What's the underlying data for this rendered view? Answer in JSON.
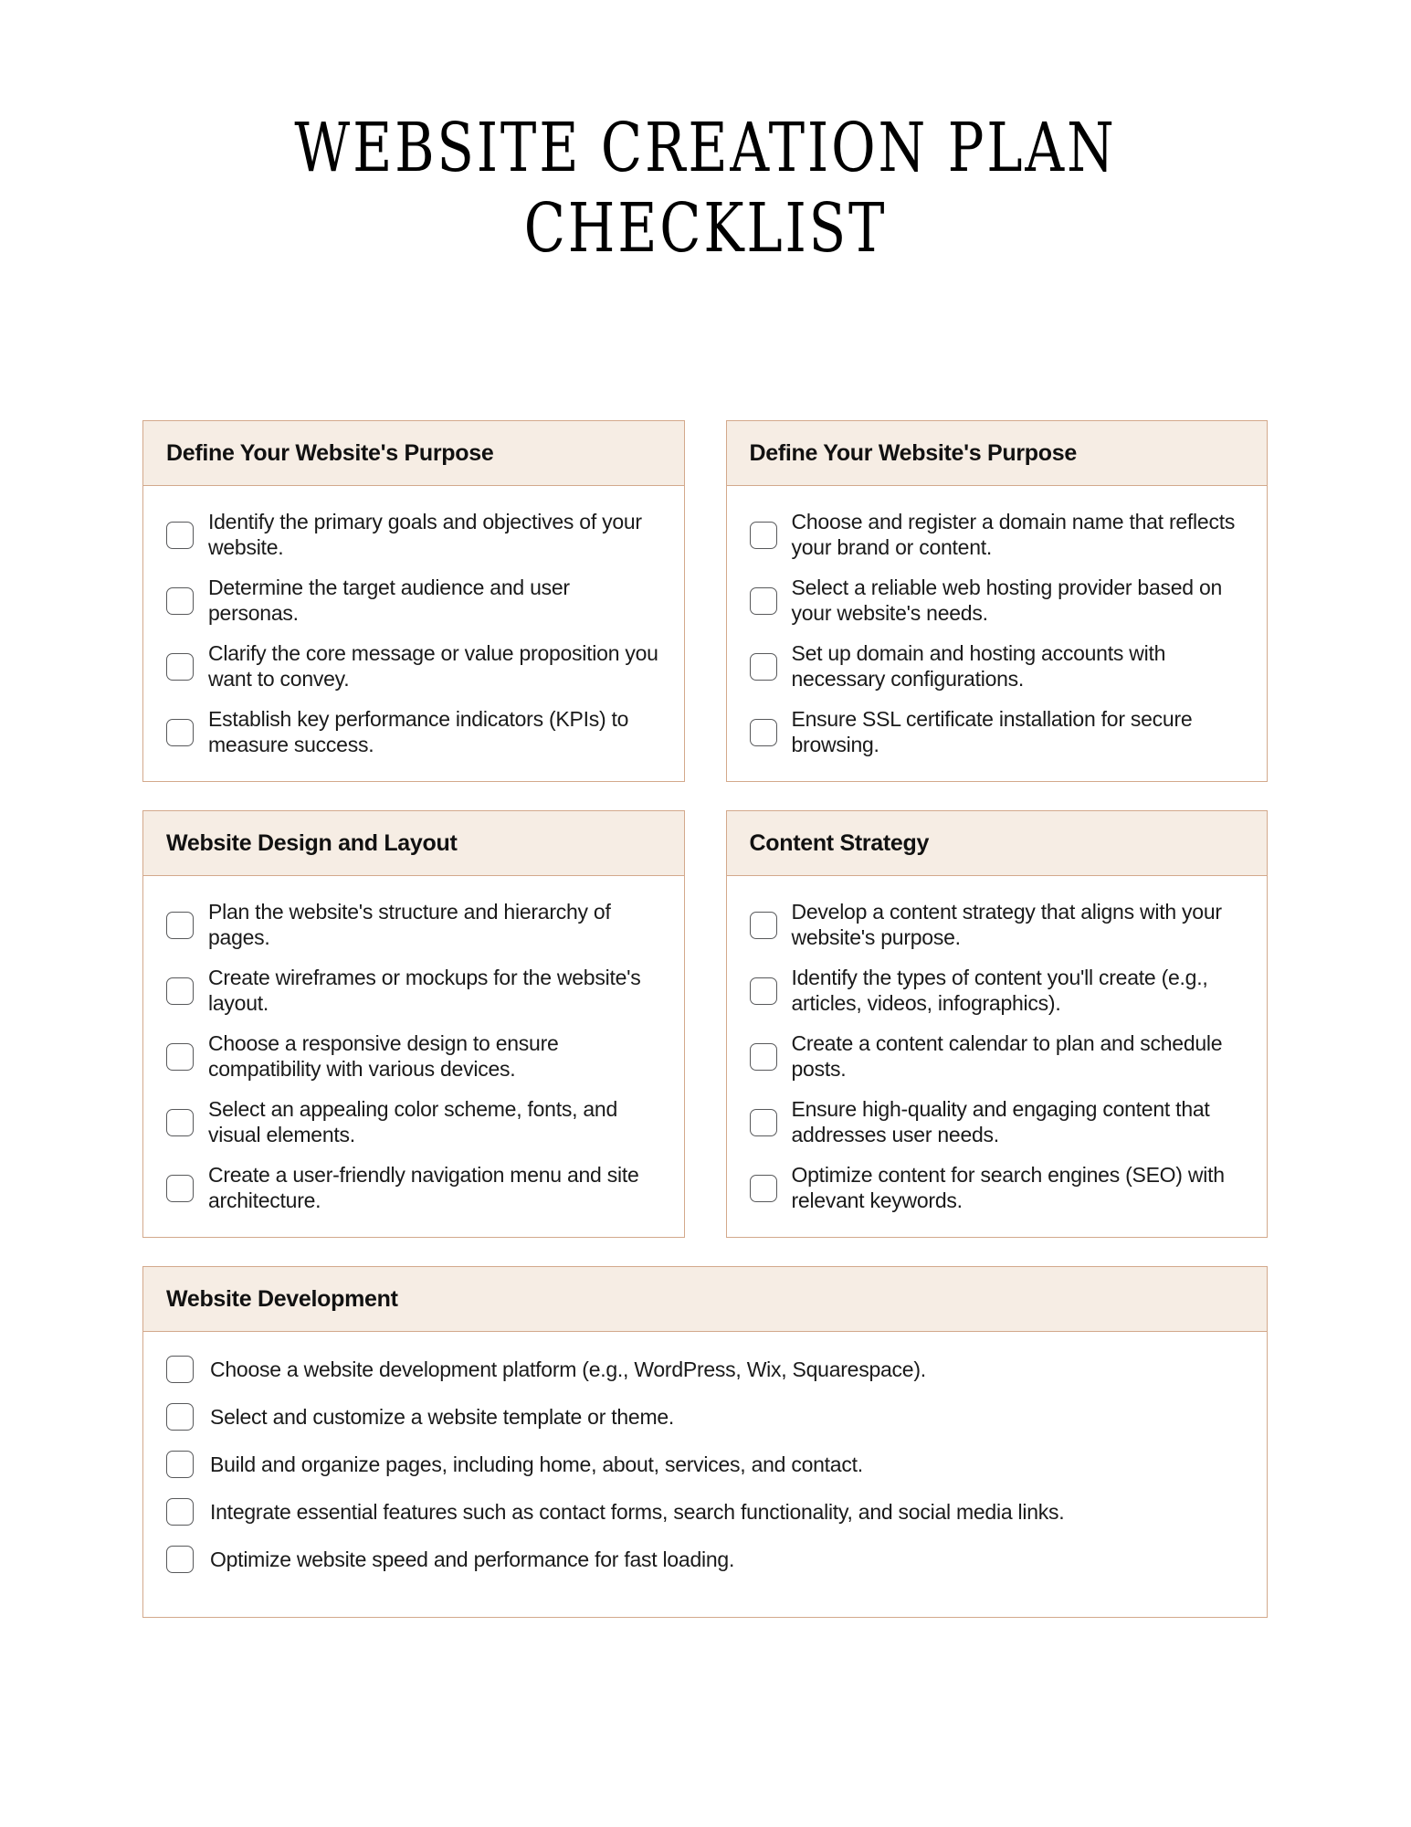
{
  "document": {
    "title": "WEBSITE CREATION PLAN CHECKLIST"
  },
  "theme": {
    "header_background": "#f6ede4",
    "border": "#d3a98c",
    "checkbox_border": "#58595b",
    "text": "#1a1a1a",
    "page_background": "#ffffff"
  },
  "sections": [
    {
      "id": "purpose",
      "heading": "Define Your Website's Purpose",
      "items": [
        {
          "checked": false,
          "label": "Identify the primary goals and objectives of your website."
        },
        {
          "checked": false,
          "label": "Determine the target audience and user personas."
        },
        {
          "checked": false,
          "label": "Clarify the core message or value proposition you want to convey."
        },
        {
          "checked": false,
          "label": "Establish key performance indicators (KPIs) to measure success."
        }
      ]
    },
    {
      "id": "domain-hosting",
      "heading": "Define Your Website's Purpose",
      "items": [
        {
          "checked": false,
          "label": "Choose and register a domain name that reflects your brand or content."
        },
        {
          "checked": false,
          "label": "Select a reliable web hosting provider based on your website's needs."
        },
        {
          "checked": false,
          "label": "Set up domain and hosting accounts with necessary configurations."
        },
        {
          "checked": false,
          "label": "Ensure SSL certificate installation for secure browsing."
        }
      ]
    },
    {
      "id": "design-layout",
      "heading": "Website Design and Layout",
      "items": [
        {
          "checked": false,
          "label": "Plan the website's structure and hierarchy of pages."
        },
        {
          "checked": false,
          "label": "Create wireframes or mockups for the website's layout."
        },
        {
          "checked": false,
          "label": "Choose a responsive design to ensure compatibility with various devices."
        },
        {
          "checked": false,
          "label": "Select an appealing color scheme, fonts, and visual elements."
        },
        {
          "checked": false,
          "label": "Create a user-friendly navigation menu and site architecture."
        }
      ]
    },
    {
      "id": "content-strategy",
      "heading": "Content Strategy",
      "items": [
        {
          "checked": false,
          "label": "Develop a content strategy that aligns with your website's purpose."
        },
        {
          "checked": false,
          "label": "Identify the types of content you'll create (e.g., articles, videos, infographics)."
        },
        {
          "checked": false,
          "label": "Create a content calendar to plan and schedule posts."
        },
        {
          "checked": false,
          "label": "Ensure high-quality and engaging content that addresses user needs."
        },
        {
          "checked": false,
          "label": "Optimize content for search engines (SEO) with relevant keywords."
        }
      ]
    },
    {
      "id": "development",
      "heading": "Website Development",
      "items": [
        {
          "checked": false,
          "label": "Choose a website development platform (e.g., WordPress, Wix, Squarespace)."
        },
        {
          "checked": false,
          "label": "Select and customize a website template or theme."
        },
        {
          "checked": false,
          "label": "Build and organize pages, including home, about, services, and contact."
        },
        {
          "checked": false,
          "label": "Integrate essential features such as contact forms, search functionality, and social media links."
        },
        {
          "checked": false,
          "label": "Optimize website speed and performance for fast loading."
        }
      ]
    }
  ]
}
